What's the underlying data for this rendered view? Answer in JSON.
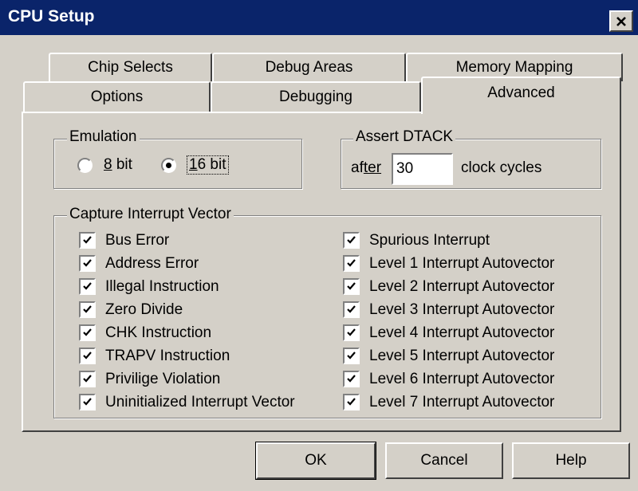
{
  "window": {
    "title": "CPU Setup",
    "close_glyph": "✕"
  },
  "tabs": {
    "back_row": [
      "Chip Selects",
      "Debug Areas",
      "Memory Mapping"
    ],
    "front_row": [
      "Options",
      "Debugging",
      "Advanced"
    ],
    "active": "Advanced"
  },
  "emulation": {
    "title": "Emulation",
    "opt_8bit_prefix": "8",
    "opt_8bit_suffix": " bit",
    "opt_16bit_prefix": "1",
    "opt_16bit_suffix": "6 bit",
    "selected": "16 bit"
  },
  "dtack": {
    "title": "Assert DTACK",
    "after_prefix": "af",
    "after_suffix": "ter",
    "value": "30",
    "units": "clock cycles"
  },
  "capture": {
    "title": "Capture Interrupt Vector",
    "left": [
      "Bus Error",
      "Address Error",
      "Illegal Instruction",
      "Zero Divide",
      "CHK Instruction",
      "TRAPV Instruction",
      "Privilige Violation",
      "Uninitialized Interrupt Vector"
    ],
    "right": [
      "Spurious Interrupt",
      "Level 1 Interrupt Autovector",
      "Level 2 Interrupt Autovector",
      "Level 3 Interrupt Autovector",
      "Level 4 Interrupt Autovector",
      "Level 5 Interrupt Autovector",
      "Level 6 Interrupt Autovector",
      "Level 7 Interrupt Autovector"
    ],
    "checked": true
  },
  "buttons": {
    "ok": "OK",
    "cancel": "Cancel",
    "help": "Help"
  }
}
